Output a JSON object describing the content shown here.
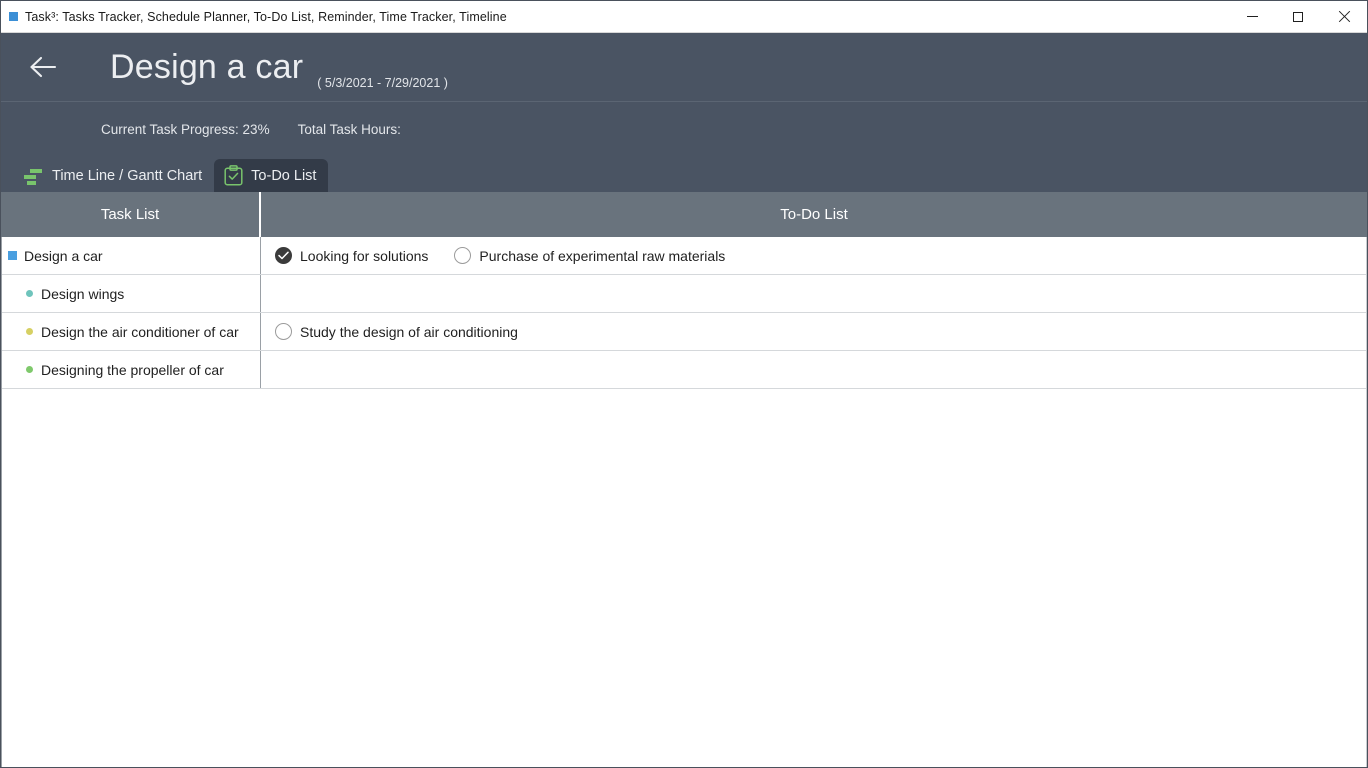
{
  "window": {
    "title": "Task³: Tasks Tracker, Schedule Planner, To-Do List, Reminder, Time Tracker, Timeline",
    "app_icon": "app-square-icon",
    "controls": {
      "minimize": "minimize-icon",
      "maximize": "maximize-icon",
      "close": "close-icon"
    }
  },
  "header": {
    "back_icon": "back-arrow-icon",
    "title": "Design a car",
    "date_range": "( 5/3/2021 - 7/29/2021 )",
    "progress_label": "Current Task Progress: 23%",
    "hours_label": "Total Task Hours:",
    "background_color": "#4a5463"
  },
  "tabs": [
    {
      "label": "Time Line / Gantt Chart",
      "icon": "gantt-chart-icon",
      "active": false
    },
    {
      "label": "To-Do List",
      "icon": "clipboard-check-icon",
      "active": true
    }
  ],
  "table": {
    "headers": {
      "task_list": "Task List",
      "todo_list": "To-Do List"
    },
    "header_background": "#69737d",
    "rows": [
      {
        "task": "Design a car",
        "bullet": "square",
        "bullet_color": "#4a9fe0",
        "level": 0,
        "todos": [
          {
            "label": "Looking for solutions",
            "checked": true
          },
          {
            "label": "Purchase of experimental raw materials",
            "checked": false
          }
        ]
      },
      {
        "task": "Design wings",
        "bullet": "dot",
        "bullet_color": "#6fc4bc",
        "level": 1,
        "todos": []
      },
      {
        "task": "Design the air conditioner of car",
        "bullet": "dot",
        "bullet_color": "#d6d063",
        "level": 1,
        "todos": [
          {
            "label": "Study the design of air conditioning",
            "checked": false
          }
        ]
      },
      {
        "task": "Designing the propeller of car",
        "bullet": "dot",
        "bullet_color": "#7fc96c",
        "level": 1,
        "todos": []
      }
    ]
  }
}
